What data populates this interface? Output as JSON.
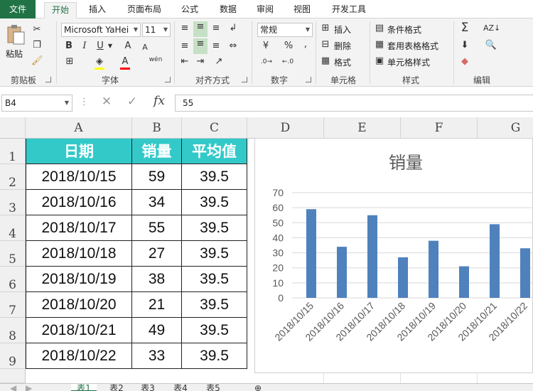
{
  "ribbon_tabs": [
    "文件",
    "开始",
    "插入",
    "页面布局",
    "公式",
    "数据",
    "审阅",
    "视图",
    "开发工具"
  ],
  "active_tab": "开始",
  "clipboard": {
    "paste_label": "粘贴",
    "group_label": "剪贴板"
  },
  "font": {
    "name": "Microsoft YaHei",
    "size": "11",
    "group_label": "字体",
    "bold": "B",
    "italic": "I",
    "underline": "U",
    "grow": "A",
    "shrink": "A",
    "wen": "wén"
  },
  "alignment": {
    "group_label": "对齐方式"
  },
  "number": {
    "format": "常规",
    "percent": "%",
    "comma": ",",
    "group_label": "数字"
  },
  "cells": {
    "insert": "插入",
    "delete": "删除",
    "format": "格式",
    "group_label": "单元格"
  },
  "styles": {
    "conditional": "条件格式",
    "table": "套用表格格式",
    "cell_styles": "单元格样式",
    "group_label": "样式"
  },
  "editing": {
    "group_label": "编辑"
  },
  "formula_bar": {
    "name_box": "B4",
    "fx": "fx",
    "value": "55"
  },
  "columns": [
    "A",
    "B",
    "C",
    "D",
    "E",
    "F",
    "G"
  ],
  "rows": [
    "1",
    "2",
    "3",
    "4",
    "5",
    "6",
    "7",
    "8",
    "9"
  ],
  "table": {
    "headers": [
      "日期",
      "销量",
      "平均值"
    ],
    "rows": [
      [
        "2018/10/15",
        "59",
        "39.5"
      ],
      [
        "2018/10/16",
        "34",
        "39.5"
      ],
      [
        "2018/10/17",
        "55",
        "39.5"
      ],
      [
        "2018/10/18",
        "27",
        "39.5"
      ],
      [
        "2018/10/19",
        "38",
        "39.5"
      ],
      [
        "2018/10/20",
        "21",
        "39.5"
      ],
      [
        "2018/10/21",
        "49",
        "39.5"
      ],
      [
        "2018/10/22",
        "33",
        "39.5"
      ]
    ]
  },
  "chart_data": {
    "type": "bar",
    "title": "销量",
    "categories": [
      "2018/10/15",
      "2018/10/16",
      "2018/10/17",
      "2018/10/18",
      "2018/10/19",
      "2018/10/20",
      "2018/10/21",
      "2018/10/22"
    ],
    "values": [
      59,
      34,
      55,
      27,
      38,
      21,
      49,
      33
    ],
    "ylim": [
      0,
      70
    ],
    "yticks": [
      0,
      10,
      20,
      30,
      40,
      50,
      60,
      70
    ],
    "xlabel": "",
    "ylabel": "",
    "grid": true,
    "bar_color": "#4f81bd"
  },
  "sheet_tabs": [
    "表1",
    "表2",
    "表3",
    "表4",
    "表5"
  ],
  "active_sheet": "表1",
  "colors": {
    "accent": "#217346",
    "header_fill": "#33c9c9",
    "bar": "#4f81bd"
  }
}
